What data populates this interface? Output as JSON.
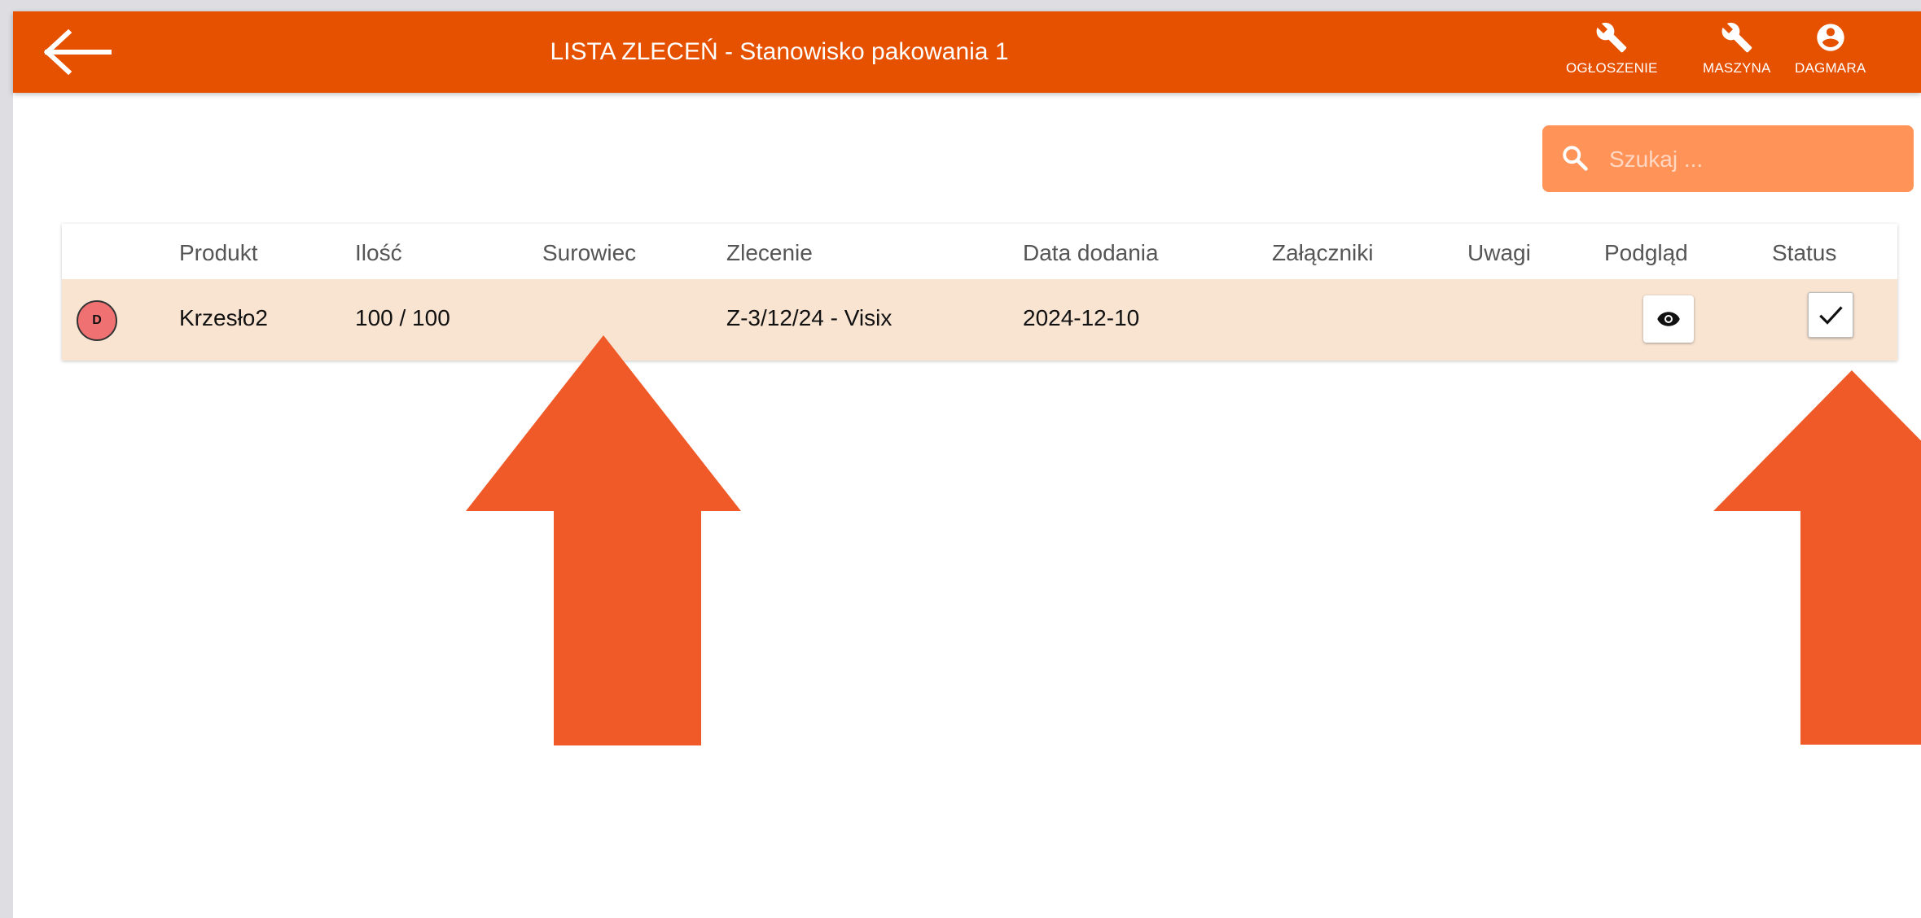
{
  "header": {
    "title": "LISTA ZLECEŃ - Stanowisko pakowania 1",
    "tools": [
      {
        "label": "OGŁOSZENIE",
        "icon": "wrench-icon"
      },
      {
        "label": "MASZYNA",
        "icon": "wrench-icon"
      },
      {
        "label": "DAGMARA",
        "icon": "account-circle-icon"
      }
    ]
  },
  "search": {
    "placeholder": "Szukaj ..."
  },
  "table": {
    "columns": [
      "Produkt",
      "Ilość",
      "Surowiec",
      "Zlecenie",
      "Data dodania",
      "Załączniki",
      "Uwagi",
      "Podgląd",
      "Status"
    ],
    "rows": [
      {
        "badge": "D",
        "produkt": "Krzesło2",
        "ilosc": "100 / 100",
        "surowiec": "",
        "zlecenie": "Z-3/12/24 - Visix",
        "data_dodania": "2024-12-10",
        "zalaczniki": "",
        "uwagi": "",
        "status_checked": true
      }
    ]
  },
  "colors": {
    "appbar": "#e65100",
    "search_bg": "#ff9358",
    "row_highlight": "#f9e4d2",
    "badge": "#ef7171",
    "annotation_arrow": "#f05a28"
  }
}
